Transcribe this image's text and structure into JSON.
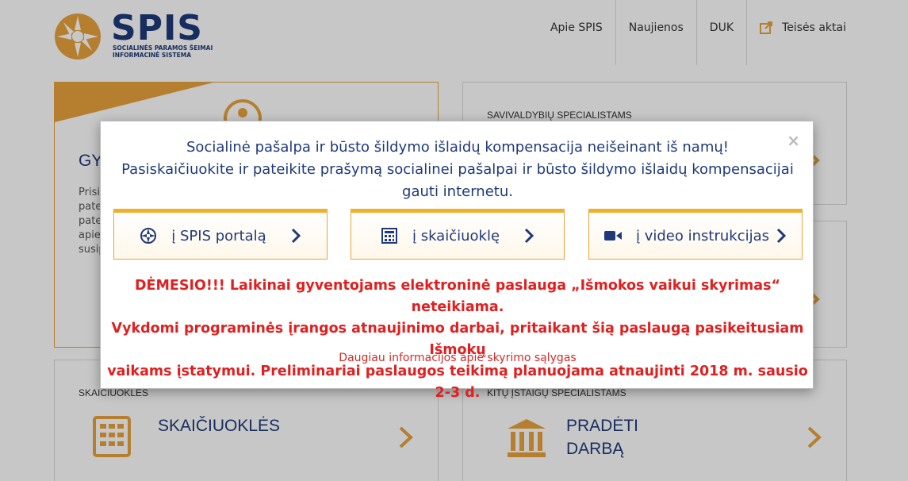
{
  "logo": {
    "word": "SPIS",
    "subtitle_line1": "SOCIALINĖS PARAMOS ŠEIMAI",
    "subtitle_line2": "INFORMACINĖ SISTEMA"
  },
  "nav": {
    "items": [
      {
        "label": "Apie SPIS"
      },
      {
        "label": "Naujienos"
      },
      {
        "label": "DUK"
      },
      {
        "label": "Teisės aktai"
      }
    ]
  },
  "cards": {
    "residents": {
      "title_partial": "GY",
      "text_lines": [
        "Prisi",
        "pate",
        "pate",
        "apie",
        "susip"
      ]
    },
    "municipal": {
      "label": "SAVIVALDYBIŲ SPECIALISTAMS"
    },
    "calculators": {
      "label": "SKAIČIUOKLĖS",
      "title": "SKAIČIUOKLĖS"
    },
    "other_institutions": {
      "label": "KITŲ ĮSTAIGŲ SPECIALISTAMS",
      "title_line1": "PRADĖTI",
      "title_line2": "DARBĄ"
    }
  },
  "modal": {
    "title_line1": "Socialinė pašalpa ir būsto šildymo išlaidų kompensacija neišeinant iš namų!",
    "title_line2": "Pasiskaičiuokite ir pateikite prašymą socialinei pašalpai ir būsto šildymo išlaidų kompensacijai",
    "title_line3": "gauti internetu.",
    "close": "×",
    "buttons": [
      {
        "label": "į SPIS portalą",
        "icon": "spis-logo-icon"
      },
      {
        "label": "į skaičiuoklę",
        "icon": "calculator-icon"
      },
      {
        "label": "į video instrukcijas",
        "icon": "video-camera-icon"
      }
    ],
    "warning_line1": "DĖMESIO!!! Laikinai gyventojams elektroninė paslauga „Išmokos vaikui skyrimas“ neteikiama.",
    "warning_line2": "Vykdomi programinės įrangos atnaujinimo darbai, pritaikant šią paslaugą pasikeitusiam Išmokų",
    "warning_line3": "vaikams įstatymui. Preliminariai paslaugos teikimą planuojama atnaujinti 2018 m. sausio 2-3 d.",
    "more_link": "Daugiau informacijos apie skyrimo sąlygas"
  },
  "colors": {
    "brand_blue": "#1f3a7a",
    "accent_orange": "#e8a33d",
    "warning_red": "#e02020"
  }
}
